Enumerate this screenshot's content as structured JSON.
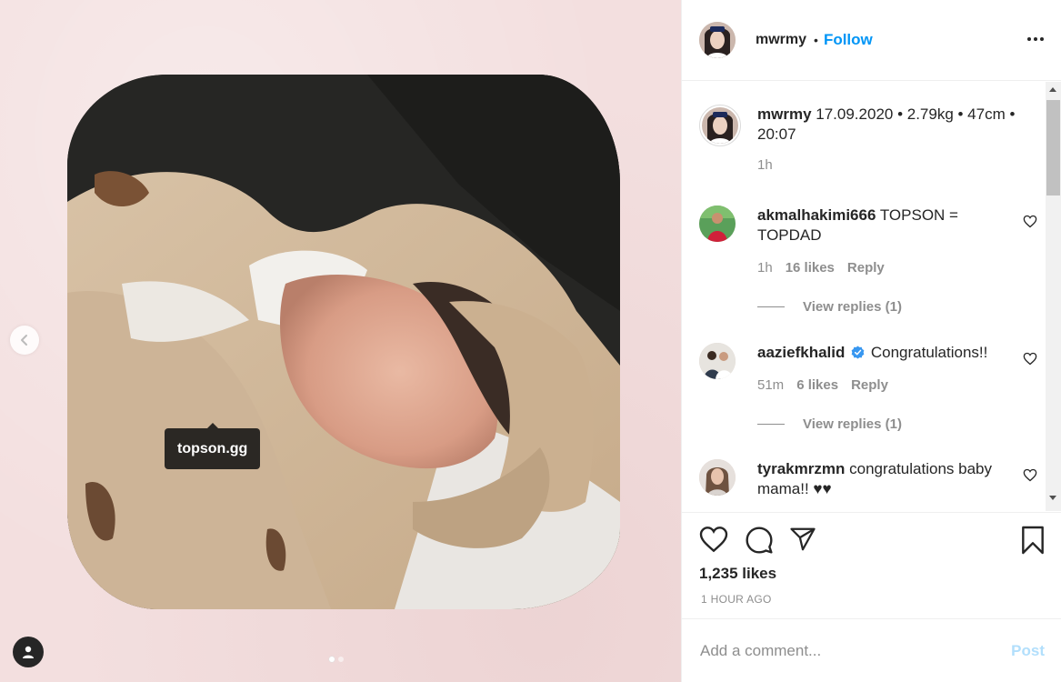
{
  "post": {
    "username": "mwrmy",
    "follow_label": "Follow",
    "separator": "•",
    "more_icon": "more-horizontal-icon"
  },
  "media": {
    "tag_label": "topson.gg",
    "prev_icon": "chevron-left-icon",
    "user_tag_icon": "user-icon",
    "carousel_count": 2,
    "carousel_active": 1
  },
  "caption": {
    "username": "mwrmy",
    "text": "17.09.2020 • 2.79kg • 47cm • 20:07",
    "time": "1h"
  },
  "comments": [
    {
      "username": "akmalhakimi666",
      "text": "TOPSON = TOPDAD",
      "time": "1h",
      "likes": "16 likes",
      "reply_label": "Reply",
      "view_replies": "View replies (1)",
      "verified": false
    },
    {
      "username": "aaziefkhalid",
      "text": "Congratulations!!",
      "time": "51m",
      "likes": "6 likes",
      "reply_label": "Reply",
      "view_replies": "View replies (1)",
      "verified": true
    },
    {
      "username": "tyrakmrzmn",
      "text": "congratulations baby mama!! ♥♥",
      "verified": false
    }
  ],
  "actions": {
    "like_icon": "heart-icon",
    "comment_icon": "comment-icon",
    "share_icon": "share-icon",
    "save_icon": "bookmark-icon"
  },
  "stats": {
    "likes": "1,235 likes",
    "time_ago": "1 HOUR AGO"
  },
  "composer": {
    "placeholder": "Add a comment...",
    "post_label": "Post"
  },
  "colors": {
    "accent": "#0095f6",
    "post_disabled": "#b2dffc",
    "secondary_text": "#8e8e8e",
    "verified": "#3897f0",
    "media_background": "#f3dfdf"
  }
}
